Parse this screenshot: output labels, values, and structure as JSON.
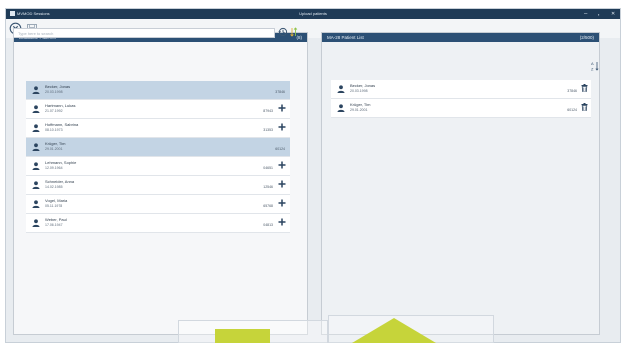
{
  "window": {
    "app_name": "MVMOD Sessions",
    "title": "Upload patients",
    "controls": [
      "–",
      "▪",
      "✕"
    ]
  },
  "toolbar": {
    "cancel_icon": "circle-x-icon",
    "save_icon": "save-icon"
  },
  "database_panel": {
    "title": "Database Patients",
    "count": "(8)",
    "search_placeholder": "Type here to search",
    "patients": [
      {
        "name": "Becker, Jonas",
        "dob": "20.03.1998",
        "id": "37846",
        "selected": true
      },
      {
        "name": "Hartmann, Lukas",
        "dob": "21.07.1992",
        "id": "87943",
        "selected": false
      },
      {
        "name": "Hoffmann, Sabrina",
        "dob": "08.10.1973",
        "id": "31353",
        "selected": false
      },
      {
        "name": "Krüger, Tim",
        "dob": "29.01.2001",
        "id": "60124",
        "selected": true
      },
      {
        "name": "Lehmann, Sophie",
        "dob": "12.09.1964",
        "id": "04651",
        "selected": false
      },
      {
        "name": "Schneider, Anna",
        "dob": "14.02.1985",
        "id": "12546",
        "selected": false
      },
      {
        "name": "Vogel, Maria",
        "dob": "05.11.1978",
        "id": "65768",
        "selected": false
      },
      {
        "name": "Weber, Paul",
        "dob": "17.06.1947",
        "id": "04813",
        "selected": false
      }
    ]
  },
  "upload_panel": {
    "title": "MA-28 Patient List",
    "count": "(2/500)",
    "patients": [
      {
        "name": "Becker, Jonas",
        "dob": "20.03.1998",
        "id": "37846"
      },
      {
        "name": "Krüger, Tim",
        "dob": "29.01.2001",
        "id": "60124"
      }
    ]
  },
  "colors": {
    "titlebar": "#1f3b57",
    "panel_header": "#2c5075",
    "selected_row": "#c3d4e4",
    "accent_green": "#c6d43a",
    "sort_orange": "#e4b23a"
  }
}
